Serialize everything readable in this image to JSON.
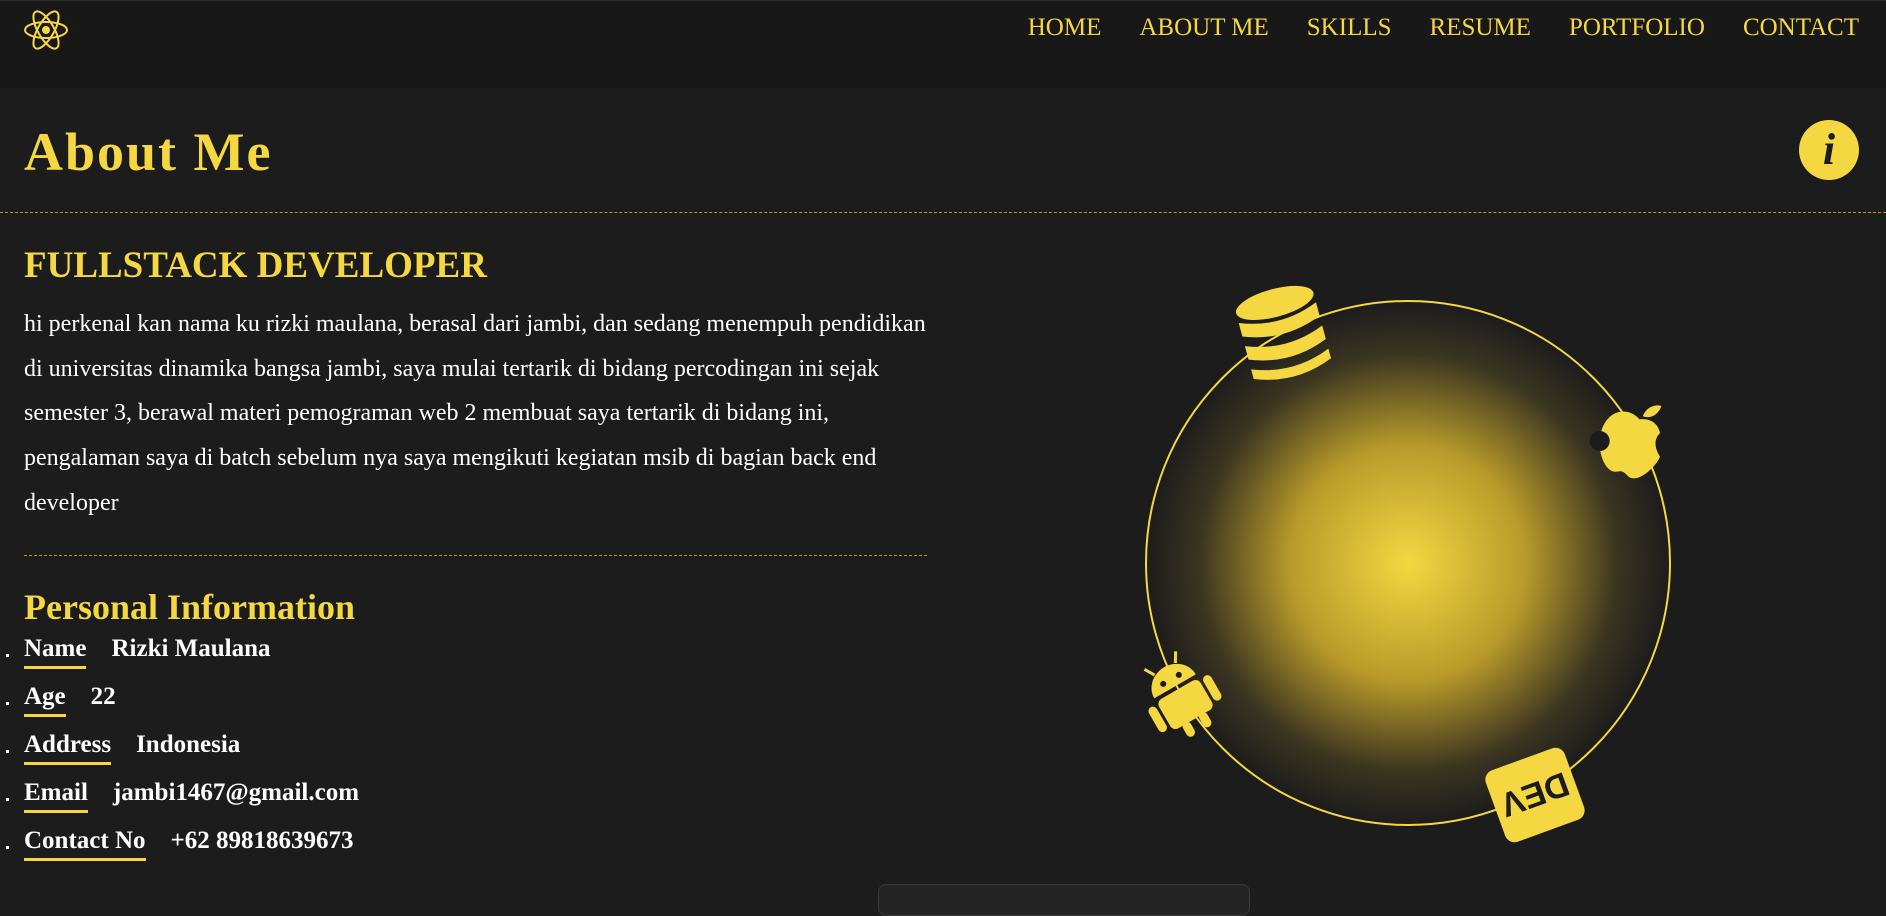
{
  "header": {
    "logo_icon": "react-atom-icon",
    "nav": [
      "HOME",
      "ABOUT ME",
      "SKILLS",
      "RESUME",
      "PORTFOLIO",
      "CONTACT"
    ]
  },
  "page": {
    "title": "About Me",
    "info_icon": "info-icon",
    "info_glyph": "i"
  },
  "about": {
    "role": "FULLSTACK DEVELOPER",
    "bio": "hi perkenal kan nama ku rizki maulana, berasal dari jambi, dan sedang menempuh pendidikan di universitas dinamika bangsa jambi, saya mulai tertarik di bidang percodingan ini sejak semester 3, berawal materi pemograman web 2 membuat saya tertarik di bidang ini, pengalaman saya di batch sebelum nya saya mengikuti kegiatan msib di bagian back end developer"
  },
  "personal": {
    "title": "Personal Information",
    "items": [
      {
        "label": "Name",
        "value": "Rizki Maulana"
      },
      {
        "label": "Age",
        "value": "22"
      },
      {
        "label": "Address",
        "value": "Indonesia"
      },
      {
        "label": "Email",
        "value": "jambi1467@gmail.com"
      },
      {
        "label": "Contact No",
        "value": "+62 89818639673"
      }
    ]
  },
  "orbit": {
    "icons": [
      "database-icon",
      "apple-icon",
      "android-icon",
      "dev-icon"
    ],
    "dev_text": "DEV"
  },
  "colors": {
    "accent": "#f5d742",
    "background": "#1c1c1c",
    "header": "#181818"
  }
}
